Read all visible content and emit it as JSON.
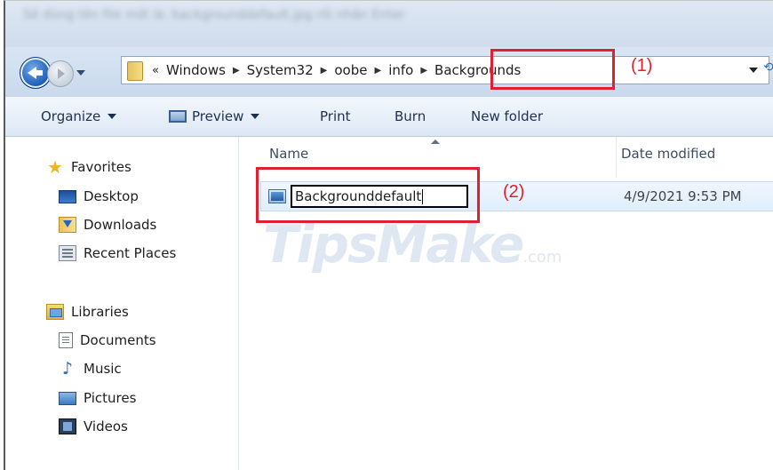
{
  "window": {
    "title_text": "Sẽ dùng tên file mới là: backgrounddefault.jpg rồi nhấn Enter"
  },
  "address_bar": {
    "overflow": "«",
    "crumbs": [
      "Windows",
      "System32",
      "oobe",
      "info",
      "Backgrounds"
    ]
  },
  "toolbar": {
    "organize": "Organize",
    "preview": "Preview",
    "print": "Print",
    "burn": "Burn",
    "new_folder": "New folder"
  },
  "nav": {
    "favorites": {
      "header": "Favorites",
      "items": [
        "Desktop",
        "Downloads",
        "Recent Places"
      ]
    },
    "libraries": {
      "header": "Libraries",
      "items": [
        "Documents",
        "Music",
        "Pictures",
        "Videos"
      ]
    }
  },
  "columns": {
    "name": "Name",
    "date_modified": "Date modified"
  },
  "files": [
    {
      "name": "Backgrounddefault",
      "date_modified": "4/9/2021 9:53 PM"
    }
  ],
  "watermark": {
    "main": "TipsMake",
    "suffix": ".com"
  },
  "annotations": [
    "(1)",
    "(2)"
  ],
  "colors": {
    "annotation": "#e02030",
    "selection": "#dfeefc"
  }
}
